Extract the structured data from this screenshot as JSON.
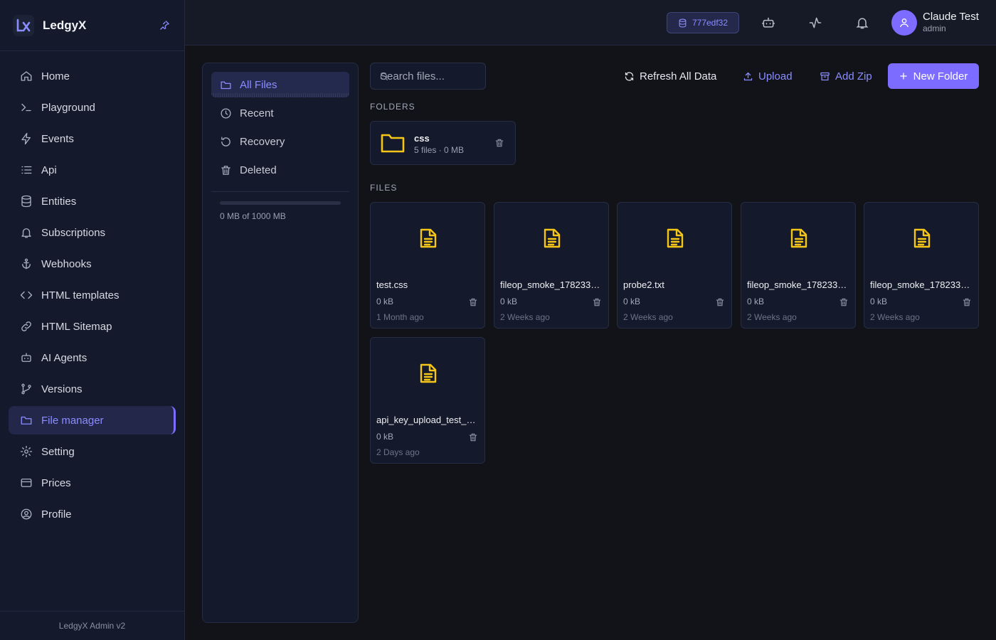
{
  "brand": {
    "name": "LedgyX"
  },
  "sidebar": {
    "items": [
      {
        "label": "Home",
        "icon": "home-icon"
      },
      {
        "label": "Playground",
        "icon": "terminal-icon"
      },
      {
        "label": "Events",
        "icon": "bolt-icon"
      },
      {
        "label": "Api",
        "icon": "list-icon"
      },
      {
        "label": "Entities",
        "icon": "database-icon"
      },
      {
        "label": "Subscriptions",
        "icon": "bell-icon"
      },
      {
        "label": "Webhooks",
        "icon": "anchor-icon"
      },
      {
        "label": "HTML templates",
        "icon": "code-icon"
      },
      {
        "label": "HTML Sitemap",
        "icon": "link-icon"
      },
      {
        "label": "AI Agents",
        "icon": "robot-icon"
      },
      {
        "label": "Versions",
        "icon": "branch-icon"
      },
      {
        "label": "File manager",
        "icon": "folder-icon",
        "active": true
      },
      {
        "label": "Setting",
        "icon": "gear-icon"
      },
      {
        "label": "Prices",
        "icon": "card-icon"
      },
      {
        "label": "Profile",
        "icon": "user-circle-icon"
      }
    ],
    "footer": "LedgyX Admin v2"
  },
  "topbar": {
    "project_id": "777edf32",
    "user_name": "Claude Test",
    "user_role": "admin"
  },
  "panel": {
    "items": [
      {
        "label": "All Files",
        "icon": "folder-icon",
        "active": true
      },
      {
        "label": "Recent",
        "icon": "clock-icon"
      },
      {
        "label": "Recovery",
        "icon": "restore-icon"
      },
      {
        "label": "Deleted",
        "icon": "trash-icon"
      }
    ],
    "storage_text": "0 MB of 1000 MB",
    "storage_used_fraction": 0
  },
  "toolbar": {
    "search_placeholder": "Search files...",
    "refresh_label": "Refresh All Data",
    "upload_label": "Upload",
    "add_zip_label": "Add Zip",
    "new_folder_label": "New Folder"
  },
  "sections": {
    "folders": "FOLDERS",
    "files": "FILES"
  },
  "folders": [
    {
      "name": "css",
      "meta": "5 files · 0 MB"
    }
  ],
  "files": [
    {
      "name": "test.css",
      "size": "0 kB",
      "date": "1 Month ago"
    },
    {
      "name": "fileop_smoke_1782338...",
      "size": "0 kB",
      "date": "2 Weeks ago"
    },
    {
      "name": "probe2.txt",
      "size": "0 kB",
      "date": "2 Weeks ago"
    },
    {
      "name": "fileop_smoke_1782338...",
      "size": "0 kB",
      "date": "2 Weeks ago"
    },
    {
      "name": "fileop_smoke_1782338...",
      "size": "0 kB",
      "date": "2 Weeks ago"
    },
    {
      "name": "api_key_upload_test_17...",
      "size": "0 kB",
      "date": "2 Days ago"
    }
  ],
  "colors": {
    "accent": "#7c6cff",
    "accent_text": "#8b8dff",
    "file_icon": "#f5c518",
    "background": "#111319",
    "panel": "#141a2b"
  }
}
